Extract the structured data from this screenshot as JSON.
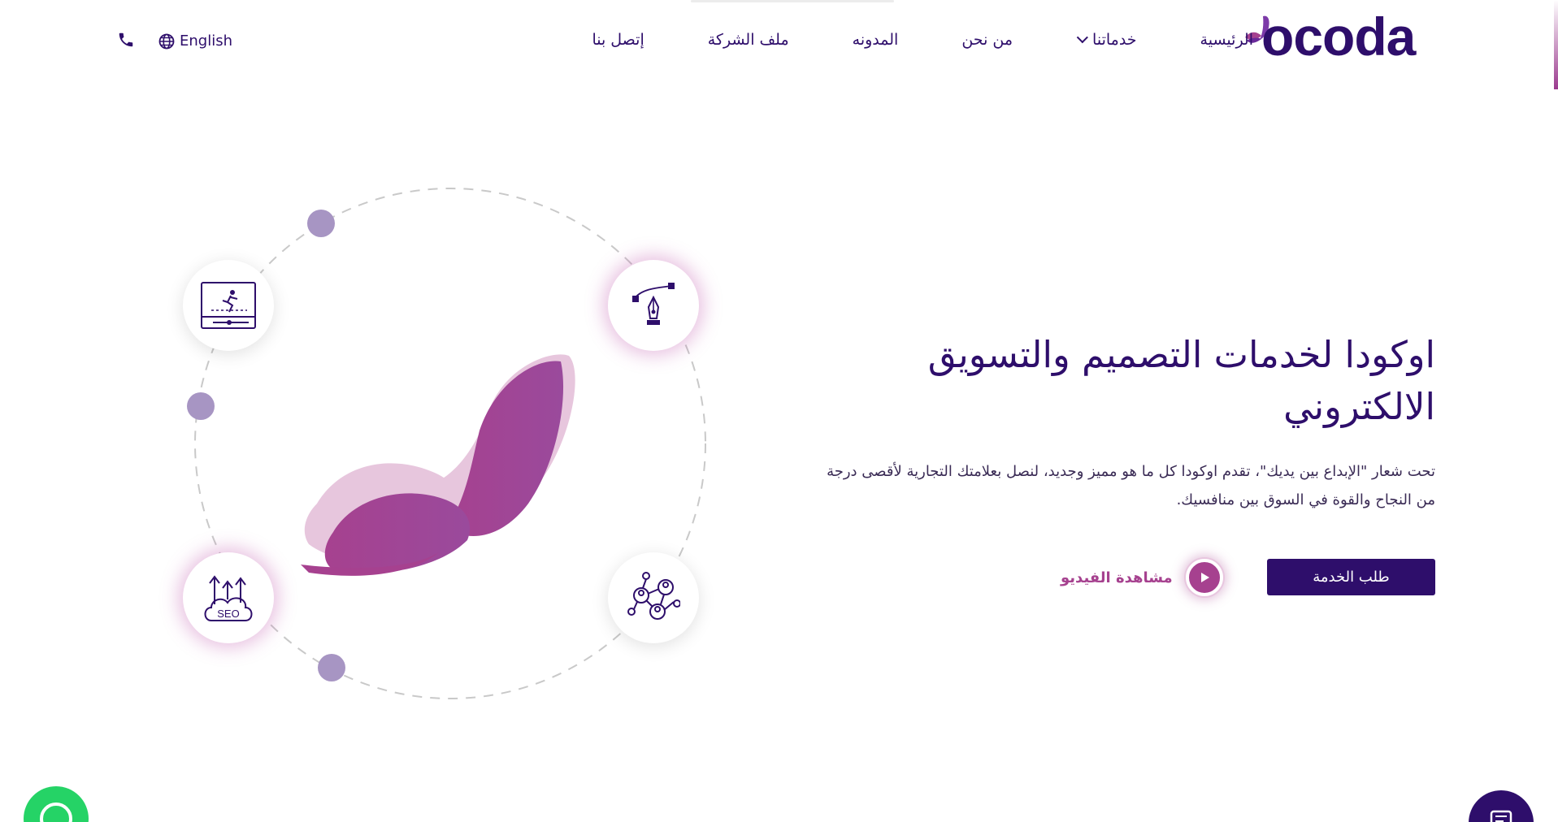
{
  "header": {
    "logo_text": "ocoda",
    "nav": [
      {
        "label": "الرئيسية",
        "dropdown": false
      },
      {
        "label": "خدماتنا",
        "dropdown": true
      },
      {
        "label": "من نحن",
        "dropdown": false
      },
      {
        "label": "المدونه",
        "dropdown": false
      },
      {
        "label": "ملف الشركة",
        "dropdown": false
      },
      {
        "label": "إتصل بنا",
        "dropdown": false
      }
    ],
    "language_label": "English",
    "icons": {
      "language": "globe-icon",
      "phone": "phone-icon",
      "dropdown": "chevron-down-icon"
    }
  },
  "hero": {
    "title": "اوكودا لخدمات التصميم والتسويق الالكتروني",
    "subtitle": "تحت شعار \"الإبداع بين يديك\"، تقدم اوكودا كل ما هو مميز وجديد، لنصل بعلامتك التجارية لأقصى درجة من النجاح والقوة في السوق بين منافسيك.",
    "request_button": "طلب الخدمة",
    "video_label": "مشاهدة الفيديو"
  },
  "illustration": {
    "icons": [
      "motion-design-icon",
      "pen-tool-icon",
      "seo-cloud-icon",
      "network-people-icon"
    ],
    "seo_text": "SEO"
  },
  "colors": {
    "primary": "#2e0e6b",
    "accent": "#a6418f",
    "orbit_dot": "#a795c3",
    "whatsapp": "#25d366"
  }
}
